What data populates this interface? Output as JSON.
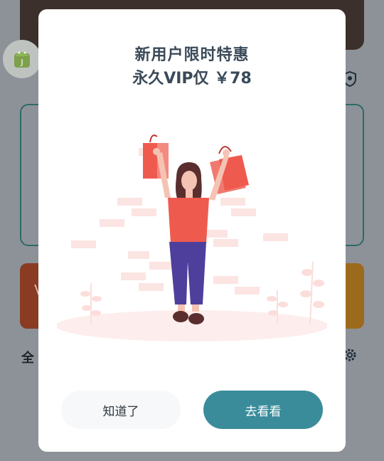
{
  "dialog": {
    "title": "新用户限时特惠",
    "subtitle": "永久VIP仅 ￥78",
    "dismiss_label": "知道了",
    "view_label": "去看看"
  },
  "background": {
    "section_title": "全",
    "left_btn_char": "V",
    "right_btn_char": "›"
  },
  "colors": {
    "accent": "#3a8c9b",
    "title_text": "#3a4a58",
    "bag": "#ef5a4f",
    "shirt": "#ef5a4f",
    "pants": "#4f3f9c",
    "hair": "#5a2e2e",
    "dim_overlay": "#8d9298"
  },
  "icons": [
    "android-icon",
    "shield-icon",
    "gear-icon"
  ]
}
